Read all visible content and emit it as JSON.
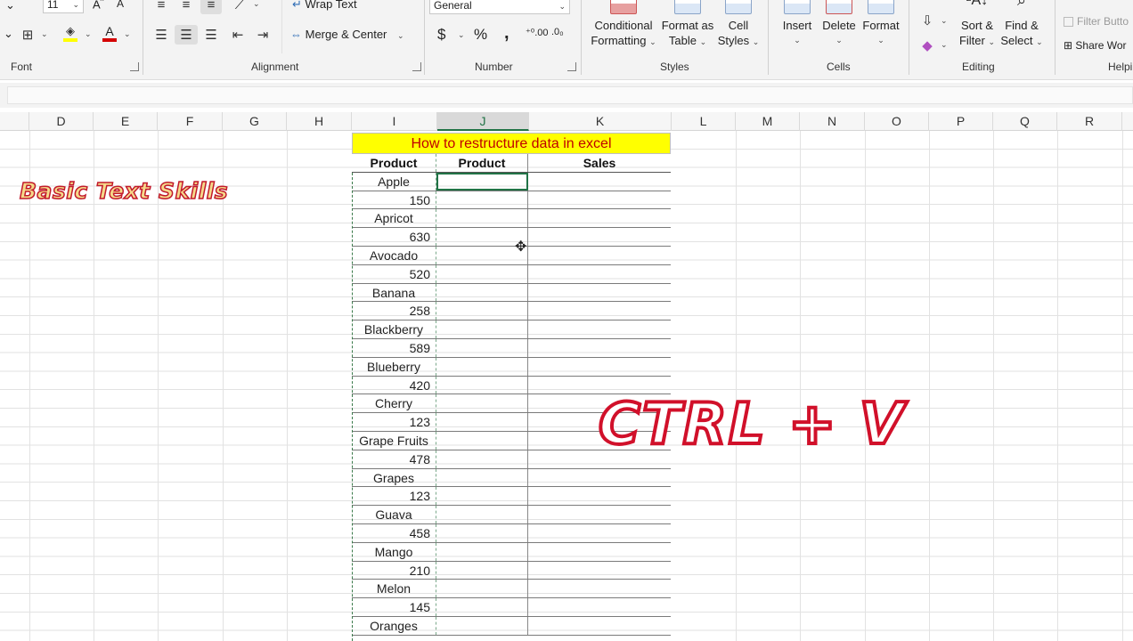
{
  "ribbon": {
    "font": {
      "size": "11",
      "group_label": "Font"
    },
    "alignment": {
      "wrap_text": "Wrap Text",
      "merge_center": "Merge & Center",
      "group_label": "Alignment"
    },
    "number": {
      "format": "General",
      "currency": "$",
      "percent": "%",
      "comma": ",",
      "group_label": "Number"
    },
    "styles": {
      "conditional_formatting": [
        "Conditional",
        "Formatting"
      ],
      "format_as_table": [
        "Format as",
        "Table"
      ],
      "cell_styles": [
        "Cell",
        "Styles"
      ],
      "group_label": "Styles"
    },
    "cells": {
      "insert": "Insert",
      "delete": "Delete",
      "format": "Format",
      "group_label": "Cells"
    },
    "editing": {
      "sort_filter": [
        "Sort &",
        "Filter"
      ],
      "find_select": [
        "Find &",
        "Select"
      ],
      "group_label": "Editing"
    },
    "helpers": {
      "filter_button": "Filter Butto",
      "share_workbook": "Share Wor",
      "group_label": "Helpi"
    }
  },
  "columns": [
    "D",
    "E",
    "F",
    "G",
    "H",
    "I",
    "J",
    "K",
    "L",
    "M",
    "N",
    "O",
    "P",
    "Q",
    "R"
  ],
  "active_column": "J",
  "table": {
    "title": "How to restructure data in excel",
    "headers": [
      "Product",
      "Product",
      "Sales"
    ],
    "source_cells": [
      "Apple",
      "150",
      "Apricot",
      "630",
      "Avocado",
      "520",
      "Banana",
      "258",
      "Blackberry",
      "589",
      "Blueberry",
      "420",
      "Cherry",
      "123",
      "Grape Fruits",
      "478",
      "Grapes",
      "123",
      "Guava",
      "458",
      "Mango",
      "210",
      "Melon",
      "145",
      "Oranges"
    ]
  },
  "overlays": {
    "caption": "Basic Text Skills",
    "shortcut": "CTRL + V"
  }
}
